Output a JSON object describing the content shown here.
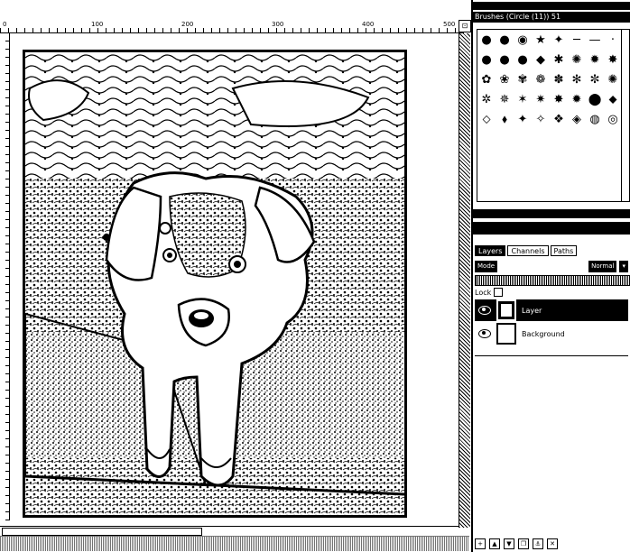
{
  "ruler": {
    "ticks": [
      "0",
      "100",
      "200",
      "300",
      "400",
      "500"
    ]
  },
  "canvas": {
    "nav_glyph": "⊡"
  },
  "brushes": {
    "header": "Brushes (Circle (11)) 51"
  },
  "panel_bars": {
    "bar1": "",
    "bar2": ""
  },
  "layers": {
    "tabs": [
      "Layers",
      "Channels",
      "Paths"
    ],
    "mode": "Mode",
    "mode_value": "Normal",
    "lock_label": "Lock",
    "items": [
      {
        "name": "Layer"
      },
      {
        "name": "Background"
      }
    ]
  },
  "icons": {
    "visible": "eye-icon",
    "buttons": [
      "new-layer-icon",
      "raise-icon",
      "lower-icon",
      "duplicate-icon",
      "anchor-icon",
      "delete-icon"
    ]
  }
}
